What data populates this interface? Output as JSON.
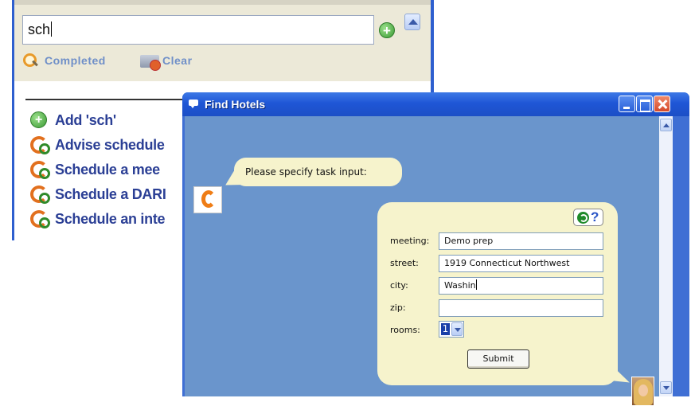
{
  "task_window": {
    "search_value": "sch",
    "filter_completed_label": "Completed",
    "filter_clear_label": "Clear",
    "tasks": [
      {
        "label": "Add 'sch'",
        "icon": "add-icon"
      },
      {
        "label": "Advise schedule",
        "icon": "task-icon"
      },
      {
        "label": "Schedule a mee",
        "icon": "task-icon"
      },
      {
        "label": "Schedule a DARI",
        "icon": "task-icon"
      },
      {
        "label": "Schedule an inte",
        "icon": "task-icon"
      }
    ]
  },
  "dialog": {
    "title": "Find Hotels",
    "prompt": "Please specify task input:",
    "form": {
      "meeting_label": "meeting:",
      "meeting_value": "Demo prep",
      "street_label": "street:",
      "street_value": "1919 Connecticut Northwest",
      "city_label": "city:",
      "city_value": "Washin",
      "zip_label": "zip:",
      "zip_value": "",
      "rooms_label": "rooms:",
      "rooms_value": "1",
      "submit_label": "Submit"
    }
  },
  "colors": {
    "titlebar": "#1f56d6",
    "dialog_background": "#6a95cc",
    "bubble": "#f6f3cc",
    "task_text": "#2b3f95",
    "brand_accent": "#ef7d16"
  }
}
